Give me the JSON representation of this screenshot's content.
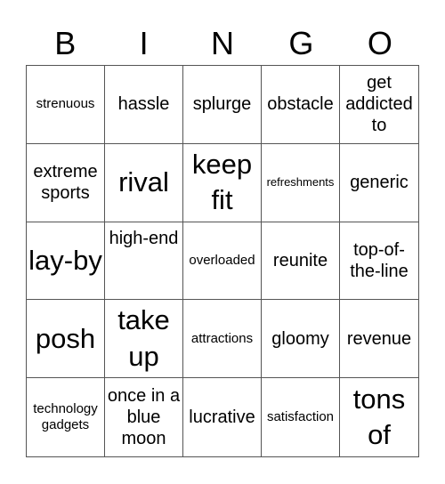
{
  "header": [
    "B",
    "I",
    "N",
    "G",
    "O"
  ],
  "cells": [
    {
      "text": "strenuous",
      "size": "s"
    },
    {
      "text": "hassle",
      "size": "m"
    },
    {
      "text": "splurge",
      "size": "m"
    },
    {
      "text": "obstacle",
      "size": "m"
    },
    {
      "text": "get addicted to",
      "size": "m"
    },
    {
      "text": "extreme sports",
      "size": "m"
    },
    {
      "text": "rival",
      "size": "l"
    },
    {
      "text": "keep fit",
      "size": "l"
    },
    {
      "text": "refreshments",
      "size": "xs"
    },
    {
      "text": "generic",
      "size": "m"
    },
    {
      "text": "lay-by",
      "size": "l"
    },
    {
      "text": "high-end",
      "size": "m",
      "align": "top"
    },
    {
      "text": "overloaded",
      "size": "s"
    },
    {
      "text": "reunite",
      "size": "m"
    },
    {
      "text": "top-of-the-line",
      "size": "m"
    },
    {
      "text": "posh",
      "size": "l"
    },
    {
      "text": "take up",
      "size": "l"
    },
    {
      "text": "attractions",
      "size": "s"
    },
    {
      "text": "gloomy",
      "size": "m"
    },
    {
      "text": "revenue",
      "size": "m"
    },
    {
      "text": "technology gadgets",
      "size": "s"
    },
    {
      "text": "once in a blue moon",
      "size": "m"
    },
    {
      "text": "lucrative",
      "size": "m"
    },
    {
      "text": "satisfaction",
      "size": "s"
    },
    {
      "text": "tons of",
      "size": "l"
    }
  ]
}
